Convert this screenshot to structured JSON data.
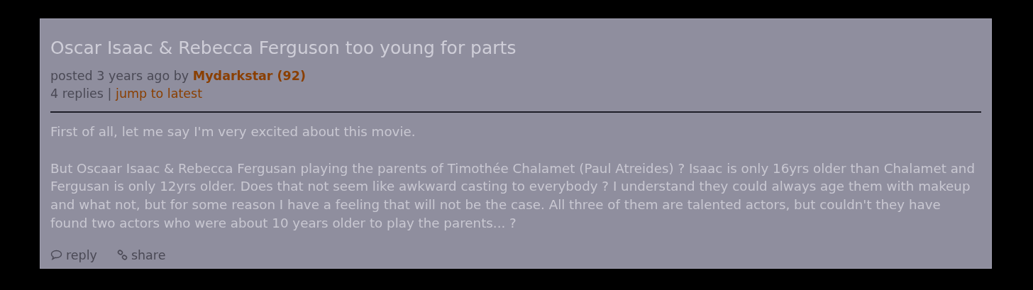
{
  "post": {
    "title": "Oscar Isaac & Rebecca Ferguson too young for parts",
    "posted": "posted 3 years ago by",
    "author": "Mydarkstar (92)",
    "replies": "4 replies |",
    "jump": "jump to latest",
    "paragraphs": [
      "First of all, let me say I'm very excited about this movie.",
      "But Oscaar Isaac & Rebecca Fergusan playing the parents of Timothée Chalamet (Paul Atreides) ? Isaac is only 16yrs older than Chalamet and Fergusan is only 12yrs older. Does that not seem like awkward casting to everybody ? I understand they could always age them with makeup and what not, but for some reason I have a feeling that will not be the case. All three of them are talented actors, but couldn't they have found two actors who were about 10 years older to play the parents... ?"
    ],
    "actions": [
      {
        "kind": "reply",
        "label": "reply"
      },
      {
        "kind": "share",
        "label": "share"
      }
    ]
  }
}
